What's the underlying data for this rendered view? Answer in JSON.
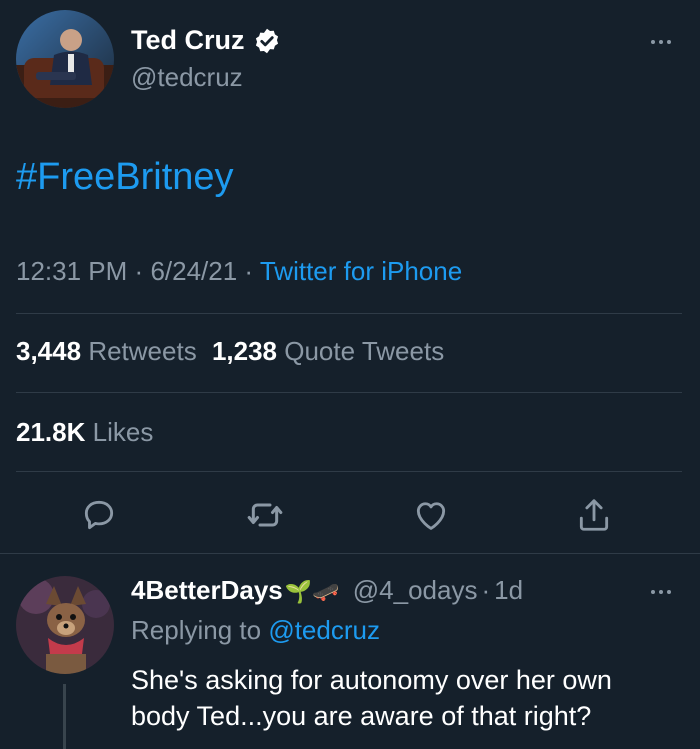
{
  "tweet": {
    "author_name": "Ted Cruz",
    "author_handle": "@tedcruz",
    "text": "#FreeBritney",
    "time": "12:31 PM",
    "date": "6/24/21",
    "separator": "·",
    "source": "Twitter for iPhone",
    "retweets_count": "3,448",
    "retweets_label": "Retweets",
    "quotes_count": "1,238",
    "quotes_label": "Quote Tweets",
    "likes_count": "21.8K",
    "likes_label": "Likes"
  },
  "reply": {
    "author_name": "4BetterDays",
    "emoji": "🌱🛹",
    "author_handle": "@4_odays",
    "separator": "·",
    "age": "1d",
    "replying_prefix": "Replying to",
    "replying_to": "@tedcruz",
    "text_line1": "She's asking for autonomy over her own",
    "text_line2": "body Ted...you are aware of that right?"
  },
  "colors": {
    "background": "#15202b",
    "accent": "#1d9bf0",
    "muted": "#8b98a5",
    "divider": "#2f3b47"
  },
  "icons": [
    "verified-badge-icon",
    "more-icon",
    "reply-icon",
    "retweet-icon",
    "like-icon",
    "share-icon"
  ]
}
